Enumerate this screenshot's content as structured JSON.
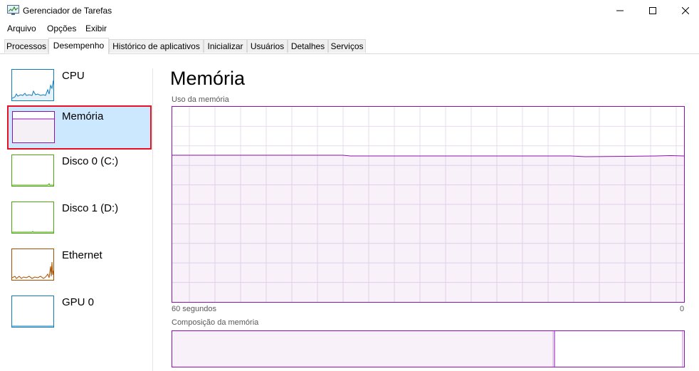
{
  "window": {
    "title": "Gerenciador de Tarefas",
    "icon": "task-manager-icon"
  },
  "menu": [
    "Arquivo",
    "Opções",
    "Exibir"
  ],
  "tabs": [
    {
      "label": "Processos",
      "active": false
    },
    {
      "label": "Desempenho",
      "active": true
    },
    {
      "label": "Histórico de aplicativos",
      "active": false
    },
    {
      "label": "Inicializar",
      "active": false
    },
    {
      "label": "Usuários",
      "active": false
    },
    {
      "label": "Detalhes",
      "active": false
    },
    {
      "label": "Serviços",
      "active": false
    }
  ],
  "sidebar": {
    "items": [
      {
        "label": "CPU",
        "color": "#117dbb",
        "selected": false
      },
      {
        "label": "Memória",
        "color": "#8b12ae",
        "selected": true
      },
      {
        "label": "Disco 0 (C:)",
        "color": "#4da60c",
        "selected": false
      },
      {
        "label": "Disco 1 (D:)",
        "color": "#4da60c",
        "selected": false
      },
      {
        "label": "Ethernet",
        "color": "#a74f01",
        "selected": false
      },
      {
        "label": "GPU 0",
        "color": "#117dbb",
        "selected": false
      }
    ]
  },
  "main": {
    "title": "Memória",
    "usage_label": "Uso da memória",
    "time_left": "60 segundos",
    "time_right": "0",
    "composition_label": "Composição da memória",
    "accent": "#8b12ae"
  }
}
